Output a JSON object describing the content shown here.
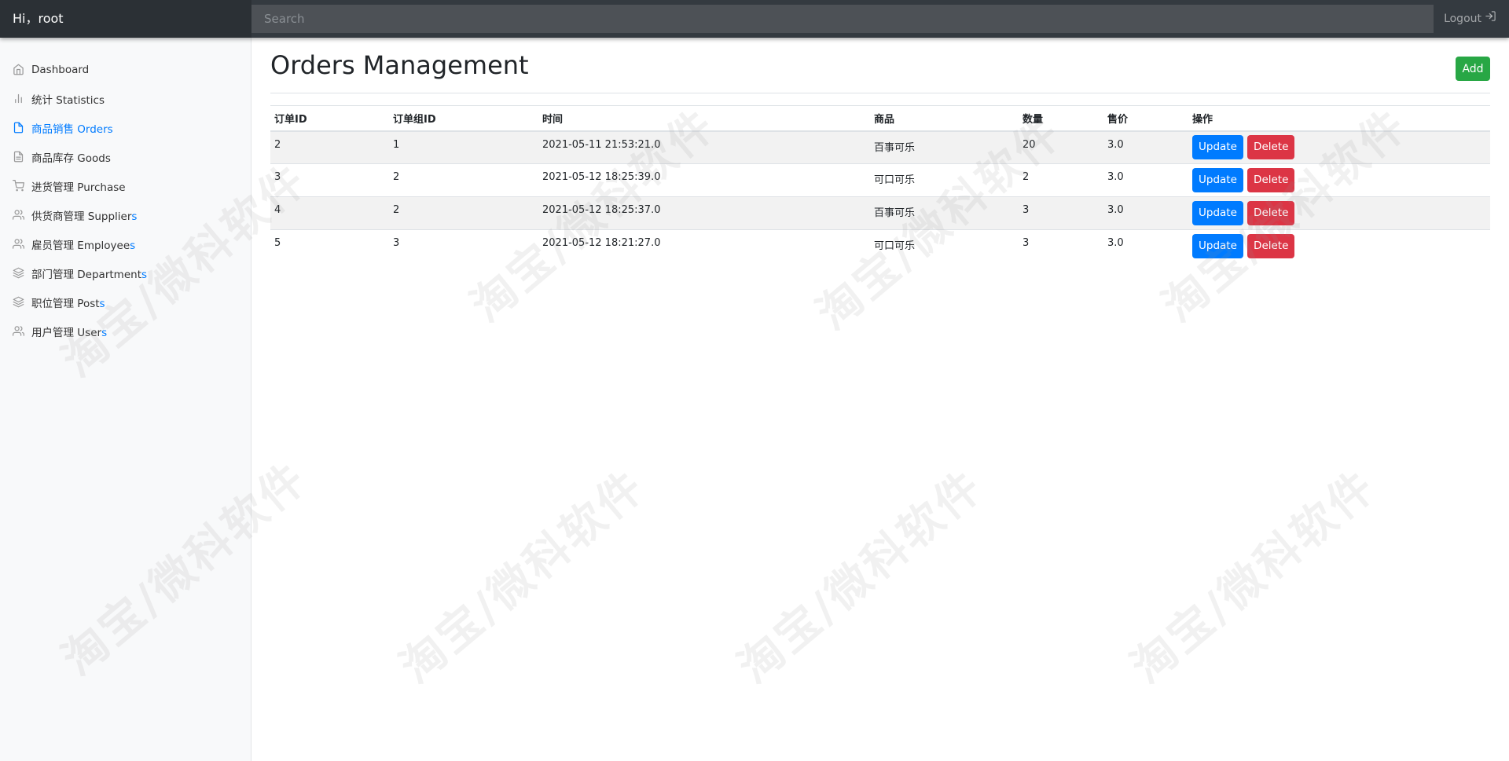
{
  "header": {
    "greeting": "Hi，root",
    "search_placeholder": "Search",
    "logout_label": "Logout"
  },
  "sidebar": {
    "items": [
      {
        "icon": "home-icon",
        "label": "Dashboard",
        "tail": "",
        "active": false
      },
      {
        "icon": "bar-chart-icon",
        "label": "统计 Statistics",
        "tail": "",
        "active": false
      },
      {
        "icon": "file-icon",
        "label": "商品销售 Orders",
        "tail": "",
        "active": true
      },
      {
        "icon": "file-text-icon",
        "label": "商品库存 Goods",
        "tail": "",
        "active": false
      },
      {
        "icon": "shopping-cart-icon",
        "label": "进货管理 Purchase",
        "tail": "",
        "active": false
      },
      {
        "icon": "users-icon",
        "label": "供货商管理 Supplier",
        "tail": "s",
        "active": false
      },
      {
        "icon": "users-icon",
        "label": "雇员管理 Employee",
        "tail": "s",
        "active": false
      },
      {
        "icon": "layers-icon",
        "label": "部门管理 Department",
        "tail": "s",
        "active": false
      },
      {
        "icon": "layers-icon",
        "label": "职位管理 Post",
        "tail": "s",
        "active": false
      },
      {
        "icon": "users-icon",
        "label": "用户管理 User",
        "tail": "s",
        "active": false
      }
    ]
  },
  "main": {
    "title": "Orders Management",
    "add_label": "Add",
    "table": {
      "headers": [
        "订单ID",
        "订单组ID",
        "时间",
        "商品",
        "数量",
        "售价",
        "操作"
      ],
      "rows": [
        [
          "2",
          "1",
          "2021-05-11 21:53:21.0",
          "百事可乐",
          "20",
          "3.0"
        ],
        [
          "3",
          "2",
          "2021-05-12 18:25:39.0",
          "可口可乐",
          "2",
          "3.0"
        ],
        [
          "4",
          "2",
          "2021-05-12 18:25:37.0",
          "百事可乐",
          "3",
          "3.0"
        ],
        [
          "5",
          "3",
          "2021-05-12 18:21:27.0",
          "可口可乐",
          "3",
          "3.0"
        ]
      ],
      "update_label": "Update",
      "delete_label": "Delete"
    }
  },
  "watermark": "淘宝/微科软件"
}
